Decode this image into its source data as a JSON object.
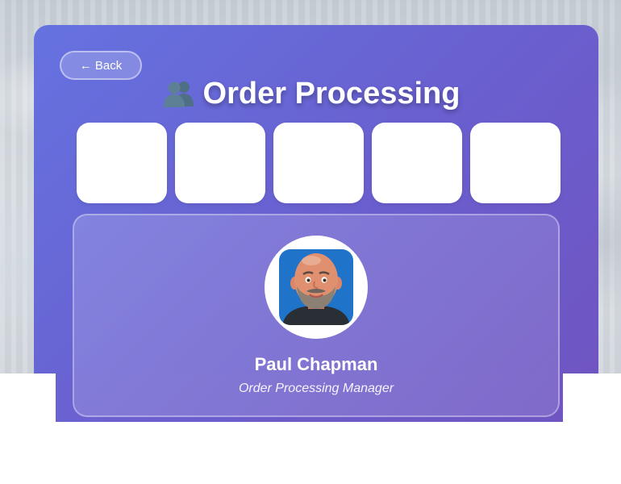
{
  "header": {
    "back_label": "← Back",
    "title": "Order Processing",
    "title_icon": "people-icon"
  },
  "stats_cards": [
    {
      "label": ""
    },
    {
      "label": ""
    },
    {
      "label": ""
    },
    {
      "label": ""
    },
    {
      "label": ""
    }
  ],
  "profile": {
    "name": "Paul Chapman",
    "role": "Order Processing Manager",
    "avatar": "bald-man-avatar"
  },
  "colors": {
    "panel_start": "#6572e0",
    "panel_end": "#6f55c2",
    "avatar_bg": "#1f73c9"
  }
}
